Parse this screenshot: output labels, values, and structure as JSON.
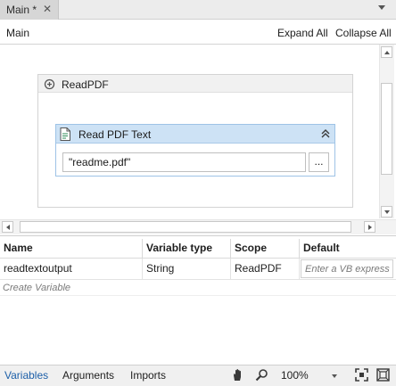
{
  "tab": {
    "label": "Main *",
    "close": "✕"
  },
  "breadcrumb": {
    "current": "Main"
  },
  "toolbar": {
    "expand_all": "Expand All",
    "collapse_all": "Collapse All"
  },
  "sequence": {
    "title": "ReadPDF",
    "icon": "sequence-icon"
  },
  "activity": {
    "title": "Read PDF Text",
    "icon": "document-icon",
    "file_path_value": "\"readme.pdf\"",
    "browse_label": "..."
  },
  "variables_panel": {
    "columns": [
      "Name",
      "Variable type",
      "Scope",
      "Default"
    ],
    "rows": [
      {
        "name": "readtextoutput",
        "type": "String",
        "scope": "ReadPDF",
        "default_placeholder": "Enter a VB express"
      }
    ],
    "create_label": "Create Variable"
  },
  "bottom_tabs": [
    "Variables",
    "Arguments",
    "Imports"
  ],
  "zoom": {
    "value": "100%"
  },
  "colors": {
    "activity_header": "#cde2f5",
    "active_tab_text": "#1c5fa8"
  }
}
